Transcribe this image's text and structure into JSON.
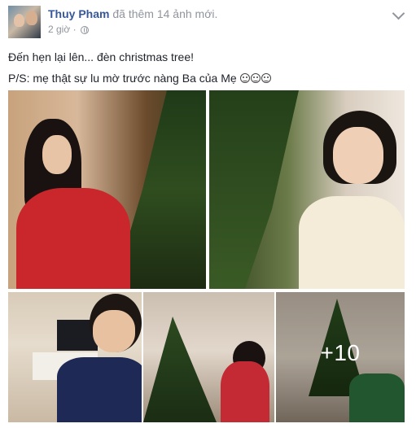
{
  "post": {
    "author": "Thuy Pham",
    "action": "đã thêm 14 ảnh mới.",
    "time": "2 giờ",
    "separator": "·",
    "lines": [
      "Đến hẹn lại lên... đèn christmas tree!",
      "P/S: mẹ thật sự lu mờ trước nàng Ba của Mẹ"
    ]
  },
  "icons": {
    "privacy": "globe-icon",
    "menu": "chevron-down-icon",
    "emoji": "smile-emoji-icon"
  },
  "gallery": {
    "more_count": "+10"
  },
  "colors": {
    "author": "#365899",
    "meta": "#90949c",
    "text": "#1d2129"
  }
}
